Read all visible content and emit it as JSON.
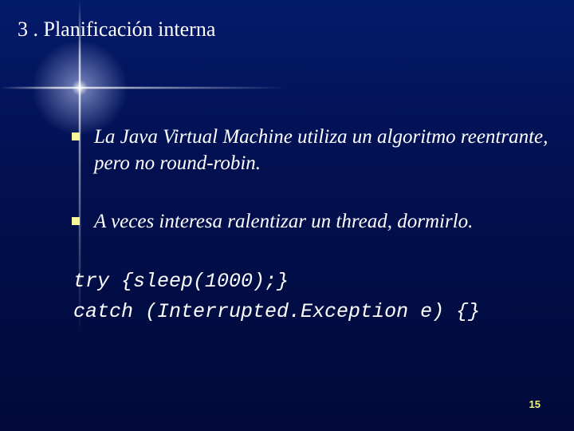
{
  "title": "3 . Planificación interna",
  "bullets": [
    "La Java Virtual Machine utiliza un algoritmo reentrante, pero no round-robin.",
    "A veces interesa ralentizar un thread, dormirlo."
  ],
  "code": {
    "line1": "try {sleep(1000);}",
    "line2": "catch (Interrupted.Exception e) {}"
  },
  "page_number": "15"
}
